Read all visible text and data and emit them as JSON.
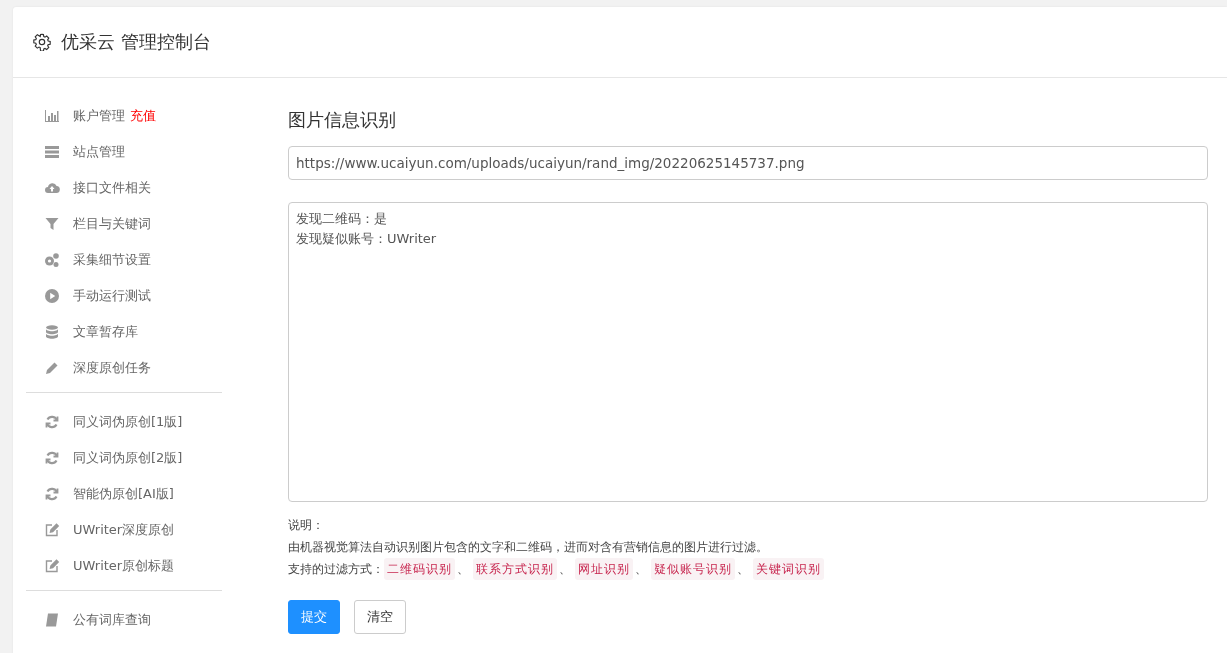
{
  "header": {
    "title": "优采云 管理控制台"
  },
  "sidebar": {
    "groups": [
      [
        {
          "label": "账户管理",
          "badge": "充值"
        },
        {
          "label": "站点管理"
        },
        {
          "label": "接口文件相关"
        },
        {
          "label": "栏目与关键词"
        },
        {
          "label": "采集细节设置"
        },
        {
          "label": "手动运行测试"
        },
        {
          "label": "文章暂存库"
        },
        {
          "label": "深度原创任务"
        }
      ],
      [
        {
          "label": "同义词伪原创[1版]"
        },
        {
          "label": "同义词伪原创[2版]"
        },
        {
          "label": "智能伪原创[AI版]"
        },
        {
          "label": "UWriter深度原创"
        },
        {
          "label": "UWriter原创标题"
        }
      ],
      [
        {
          "label": "公有词库查询"
        }
      ]
    ]
  },
  "main": {
    "title": "图片信息识别",
    "url_field": {
      "value": "https://www.ucaiyun.com/uploads/ucaiyun/rand_img/20220625145737.png"
    },
    "result_box": {
      "lines": [
        "发现二维码：是",
        "发现疑似账号：UWriter"
      ]
    },
    "note_heading": "说明：",
    "note_text": "由机器视觉算法自动识别图片包含的文字和二维码，进而对含有营销信息的图片进行过滤。",
    "filter_label": "支持的过滤方式：",
    "filter_tags": [
      "二维码识别",
      "联系方式识别",
      "网址识别",
      "疑似账号识别",
      "关键词识别"
    ],
    "separator": "、",
    "buttons": [
      {
        "label": "提交",
        "kind": "primary"
      },
      {
        "label": "清空",
        "kind": "default"
      }
    ]
  }
}
